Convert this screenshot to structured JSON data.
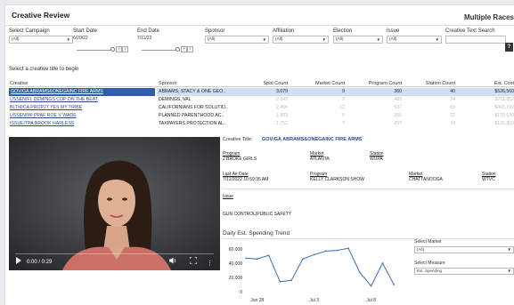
{
  "header": {
    "title": "Creative Review",
    "right_title": "Multiple Races"
  },
  "filters": {
    "campaign": {
      "label": "Select Campaign",
      "value": "(All)"
    },
    "start_date": {
      "label": "Start Date",
      "value": "6/29/22"
    },
    "end_date": {
      "label": "End Date",
      "value": "7/11/22"
    },
    "sponsor": {
      "label": "Sponsor",
      "value": "(All)"
    },
    "affiliation": {
      "label": "Affiliation",
      "value": "(All)"
    },
    "election": {
      "label": "Election",
      "value": "(All)"
    },
    "issue": {
      "label": "Issue",
      "value": "(All)"
    },
    "text_search": {
      "label": "Creative Text Search",
      "value": ""
    },
    "help_label": "?"
  },
  "section_label": "Select a creative title to begin",
  "table": {
    "headers": [
      "Creative",
      "Sponsor",
      "Spot Count",
      "Market Count",
      "Program Count",
      "Station Count",
      "Est. Cost"
    ],
    "rows": [
      {
        "creative": "GOV/GA ABRAMS&ONEGAINC FIRE ARMS",
        "sponsor": "ABRAMS, STACY & ONE GEO..",
        "spot": "3,079",
        "market": "9",
        "program": "360",
        "station": "40",
        "cost": "$526,560"
      },
      {
        "creative": "USSEN/FL DEMINGS COP ON THE BEAT",
        "sponsor": "DEMINGS, VAL",
        "spot": "2,049",
        "market": "9",
        "program": "488",
        "station": "34",
        "cost": "$711,852"
      },
      {
        "creative": "BLTM/CA PROP27 YES MY TRIBE",
        "sponsor": "CALIFORNIANS FOR SOLUTIO..",
        "spot": "2,456",
        "market": "12",
        "program": "537",
        "station": "69",
        "cost": "$465,192"
      },
      {
        "creative": "USSEN/WI PPAF ROE V WADE",
        "sponsor": "PLANNED PARENTHOOD AC..",
        "spot": "1,803",
        "market": "5",
        "program": "250",
        "station": "22",
        "cost": "$179,020"
      },
      {
        "creative": "ISSUE/TPA BROOK HARLESS",
        "sponsor": "TAXPAYERS PROTECTION AL..",
        "spot": "1,752",
        "market": "7",
        "program": "257",
        "station": "24",
        "cost": "$126,810"
      }
    ]
  },
  "video": {
    "time": "0:00 / 0:29",
    "progress": 0
  },
  "details": {
    "creative_title_label": "Creative Title:",
    "creative_title": "GOV/GA ABRAMS&ONEGAINC FIRE ARMS",
    "program_label": "Program",
    "program_value": "2 BROKE GIRLS",
    "market_label": "Market",
    "market_value": "ATLANTA",
    "station_label": "Station",
    "station_value": "WUPA",
    "last_air_label": "Last Air Date",
    "last_air_value": "7/11/2022 10:59:36 AM",
    "program2_label": "Program",
    "program2_value": "KELLY CLARKSON SHOW",
    "market2_label": "Market",
    "market2_value": "CHATTANOOGA",
    "station2_label": "Station",
    "station2_value": "WTVC",
    "issue_label": "Issue",
    "issue_value": "GUN CONTROL|PUBLIC SAFETY"
  },
  "trend": {
    "title": "Daily Est. Spending Trend",
    "select_market_label": "Select Market",
    "select_market_value": "(All)",
    "select_measure_label": "Select Measure",
    "select_measure_value": "Est. Spending"
  },
  "chart_data": {
    "type": "line",
    "title": "Daily Est. Spending Trend",
    "x": [
      "Jun 27",
      "Jun 28",
      "Jun 29",
      "Jun 30",
      "Jul 1",
      "Jul 2",
      "Jul 3",
      "Jul 4",
      "Jul 5",
      "Jul 6",
      "Jul 7",
      "Jul 8",
      "Jul 9",
      "Jul 10",
      "Jul 11"
    ],
    "values": [
      47000,
      46000,
      51000,
      14000,
      16000,
      46000,
      52000,
      57000,
      58000,
      61000,
      27000,
      8000,
      40000,
      10000,
      null
    ],
    "x_tick_labels": [
      "Jun 28",
      "Jul 3",
      "Jul 8"
    ],
    "y_ticks": [
      0,
      20000,
      40000,
      60000
    ],
    "y_tick_labels": [
      "0",
      "20,000",
      "40,000",
      "60,000"
    ],
    "ylim": [
      0,
      65000
    ],
    "color": "#4a7ab5",
    "grid": false
  },
  "colors": {
    "accent": "#2e5fa8",
    "selected_band": "#cfe0f3",
    "link": "#2b4a8f",
    "line": "#4a7ab5"
  }
}
